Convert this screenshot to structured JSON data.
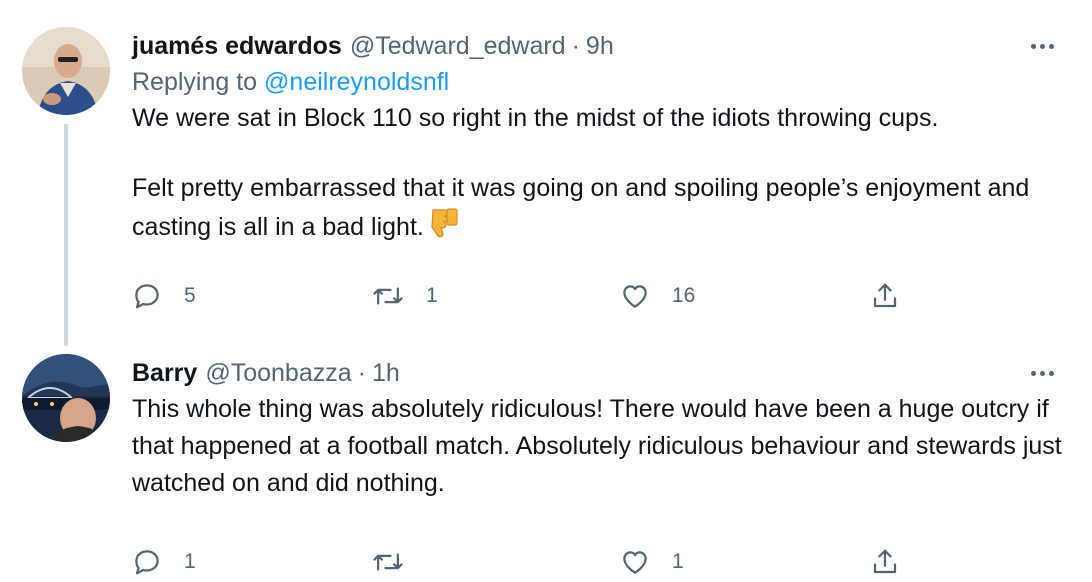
{
  "tweets": [
    {
      "author_name": "juamés edwardos",
      "handle": "@Tedward_edward",
      "separator": "·",
      "time": "9h",
      "replying_prefix": "Replying to",
      "replying_to": "@neilreynoldsnfl",
      "text_line1": "We were sat in Block 110 so right in the midst of the idiots throwing cups.",
      "text_line2": "Felt pretty embarrassed that it was going on and spoiling people’s enjoyment and casting is all in a bad light.",
      "emoji": "thumbs-down-icon",
      "replies": "5",
      "retweets": "1",
      "likes": "16"
    },
    {
      "author_name": "Barry",
      "handle": "@Toonbazza",
      "separator": "·",
      "time": "1h",
      "text": "This whole thing was absolutely ridiculous! There would have been a huge outcry if that happened at a football match. Absolutely ridiculous behaviour and stewards just watched on and did nothing.",
      "replies": "1",
      "retweets": "",
      "likes": "1"
    }
  ],
  "icons": {
    "reply": "reply-icon",
    "retweet": "retweet-icon",
    "like": "heart-icon",
    "share": "share-icon",
    "more": "more-options-icon"
  },
  "colors": {
    "text": "#0f1419",
    "secondary": "#536471",
    "link": "#1d9bf0",
    "thread_line": "#cfd9de"
  }
}
